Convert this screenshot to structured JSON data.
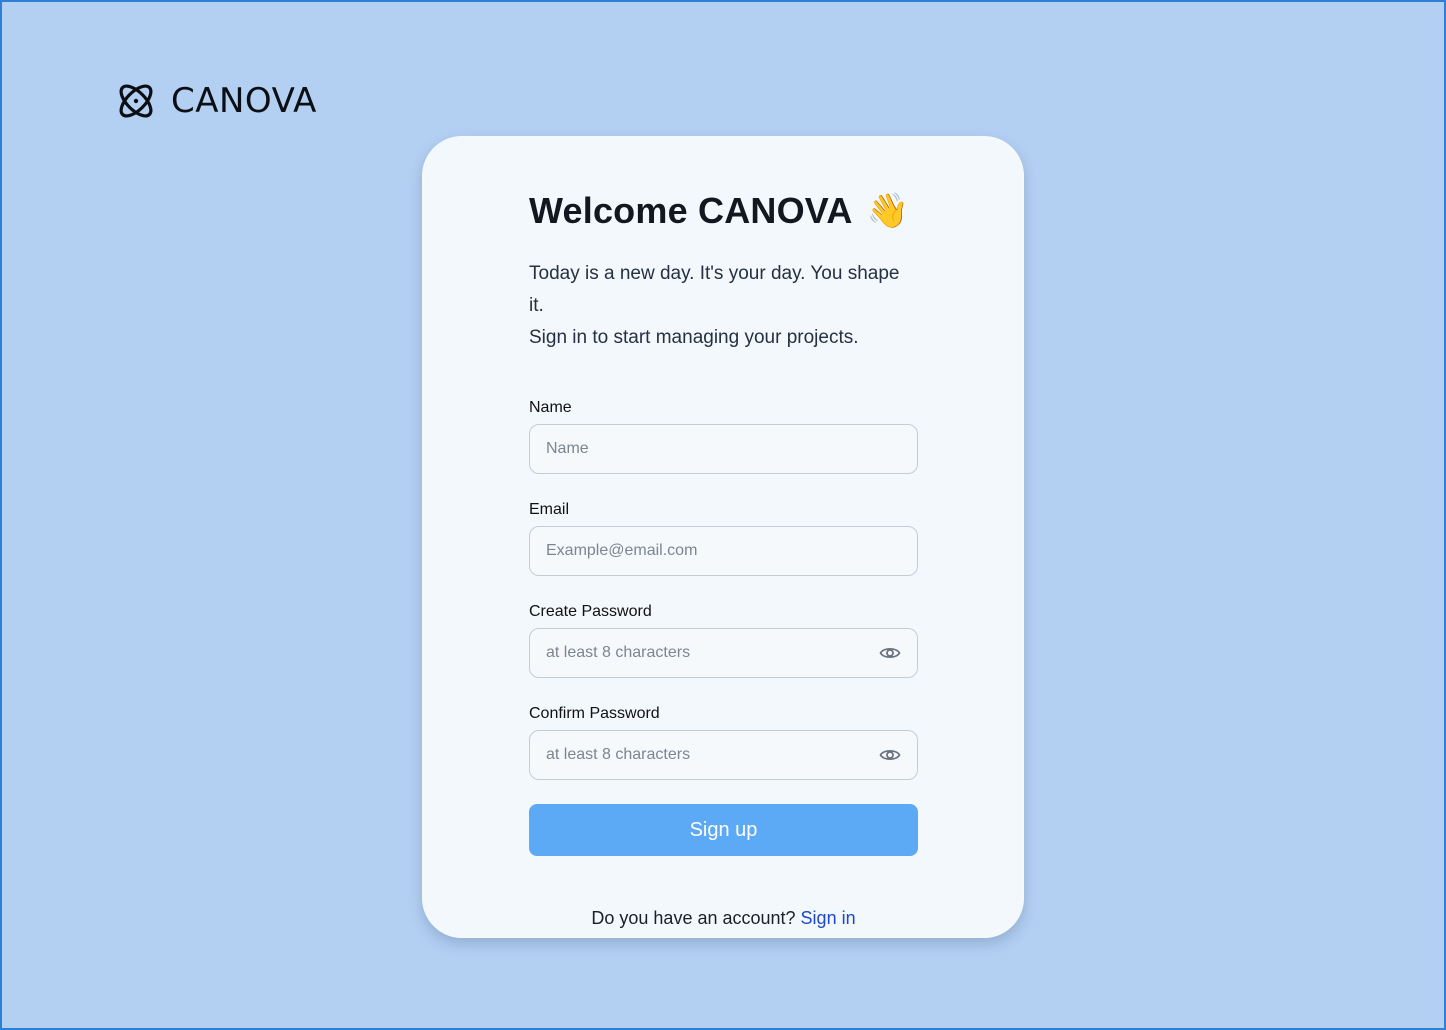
{
  "brand": {
    "name": "CANOVA",
    "icon": "atom-icon"
  },
  "card": {
    "title": "Welcome CANOVA",
    "emoji": "👋",
    "subtitle_line1": "Today is a new day. It's your day. You shape it.",
    "subtitle_line2": "Sign in to start managing your projects."
  },
  "form": {
    "name": {
      "label": "Name",
      "placeholder": "Name",
      "value": ""
    },
    "email": {
      "label": "Email",
      "placeholder": "Example@email.com",
      "value": ""
    },
    "create_password": {
      "label": "Create Password",
      "placeholder": "at least 8 characters",
      "value": "",
      "icon": "eye-icon"
    },
    "confirm_password": {
      "label": "Confirm Password",
      "placeholder": "at least 8 characters",
      "value": "",
      "icon": "eye-icon"
    },
    "submit_label": "Sign up"
  },
  "footer": {
    "prompt": "Do you have an account?",
    "link_label": "Sign in"
  },
  "colors": {
    "background": "#b3d0f3",
    "card": "#f3f8fc",
    "button": "#5ca9f5",
    "link": "#1f47c9",
    "frame_border": "#2f7fd6"
  }
}
